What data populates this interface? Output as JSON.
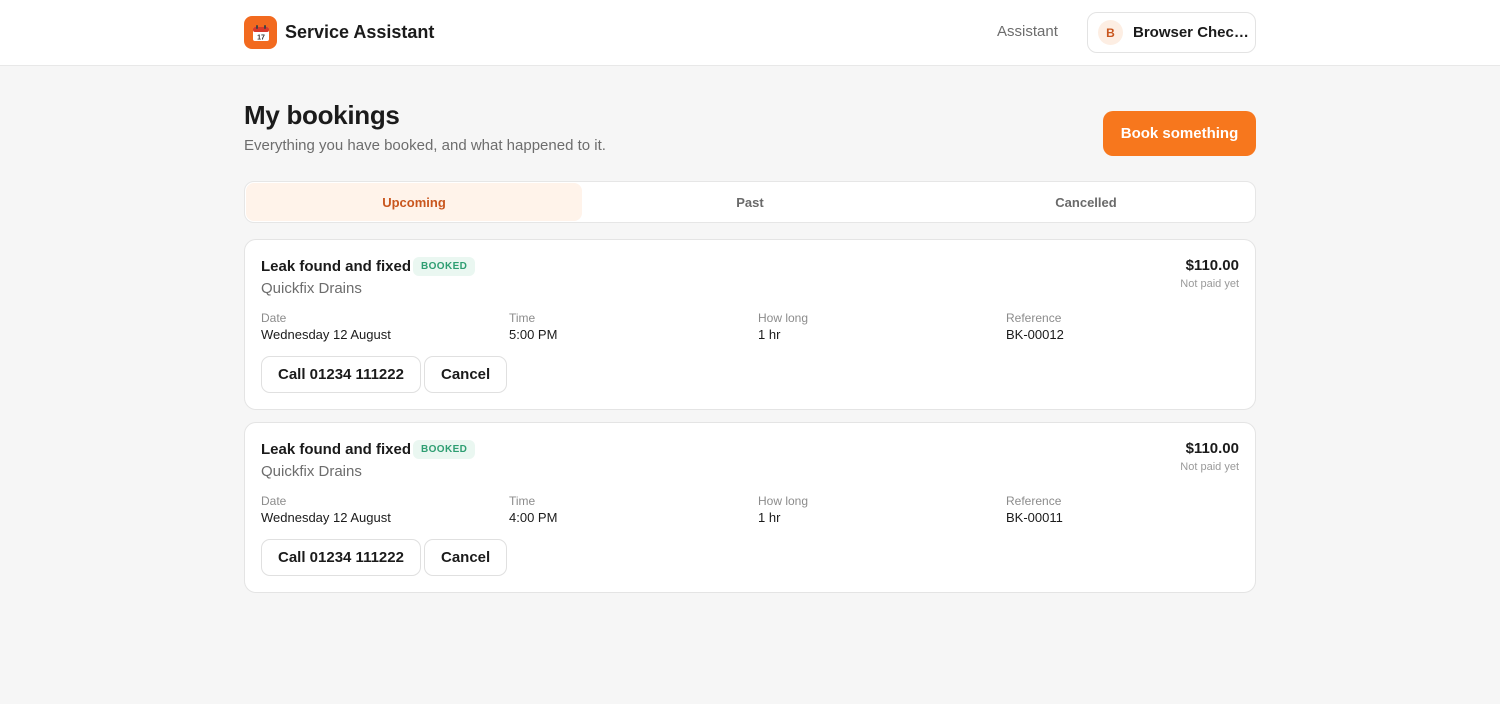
{
  "app": {
    "name": "Service Assistant",
    "logo_icon": "calendar-icon",
    "accent": "#f7771d"
  },
  "nav": {
    "assistant_label": "Assistant"
  },
  "user": {
    "initial": "B",
    "name": "Browser Check..."
  },
  "page": {
    "title": "My bookings",
    "subtitle": "Everything you have booked, and what happened to it.",
    "book_button": "Book something"
  },
  "tabs": [
    {
      "label": "Upcoming",
      "active": true
    },
    {
      "label": "Past",
      "active": false
    },
    {
      "label": "Cancelled",
      "active": false
    }
  ],
  "bookings": [
    {
      "title": "Leak found and fixed",
      "status": "BOOKED",
      "provider": "Quickfix Drains",
      "price": "$110.00",
      "payment_status": "Not paid yet",
      "fields": [
        {
          "label": "Date",
          "value": "Wednesday 12 August"
        },
        {
          "label": "Time",
          "value": "5:00 PM"
        },
        {
          "label": "How long",
          "value": "1 hr"
        },
        {
          "label": "Reference",
          "value": "BK-00012"
        }
      ],
      "call_button": "Call 01234 111222",
      "cancel_button": "Cancel"
    },
    {
      "title": "Leak found and fixed",
      "status": "BOOKED",
      "provider": "Quickfix Drains",
      "price": "$110.00",
      "payment_status": "Not paid yet",
      "fields": [
        {
          "label": "Date",
          "value": "Wednesday 12 August"
        },
        {
          "label": "Time",
          "value": "4:00 PM"
        },
        {
          "label": "How long",
          "value": "1 hr"
        },
        {
          "label": "Reference",
          "value": "BK-00011"
        }
      ],
      "call_button": "Call 01234 111222",
      "cancel_button": "Cancel"
    }
  ]
}
